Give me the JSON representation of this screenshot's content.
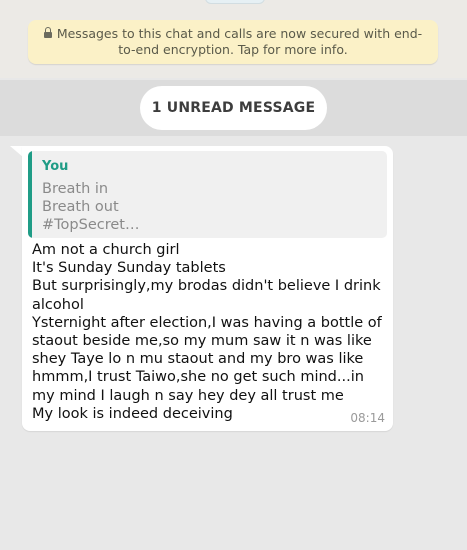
{
  "encryption_notice": {
    "text": "Messages to this chat and calls are now secured with end-to-end encryption. Tap for more info.",
    "icon": "lock-icon"
  },
  "unread_divider": {
    "label": "1 UNREAD MESSAGE"
  },
  "message": {
    "quoted": {
      "author": "You",
      "text": "Breath in\nBreath out\n#TopSecret…"
    },
    "body": "Am not a church girl\nIt's Sunday Sunday tablets\nBut surprisingly,my brodas didn't believe I drink alcohol\nYsternight after election,I was having a bottle of staout beside me,so my mum saw it n was like shey Taye lo n mu staout and my bro was like hmmm,I trust Taiwo,she no get such mind...in my mind I laugh n say hey dey all trust me\nMy look is indeed deceiving",
    "time": "08:14"
  },
  "colors": {
    "accent": "#1f9c86",
    "notice_bg": "#fbf1c7",
    "chat_bg": "#e8e8e8"
  }
}
